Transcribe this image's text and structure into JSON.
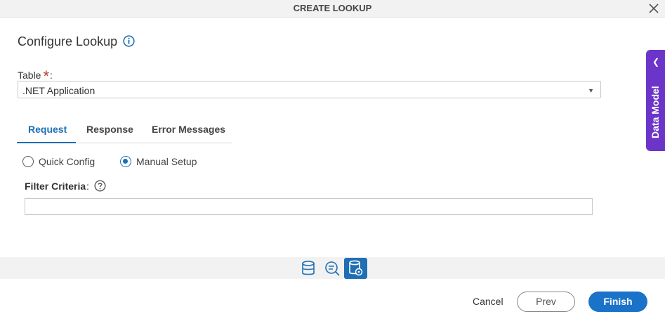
{
  "window": {
    "title": "CREATE LOOKUP",
    "close_icon": "close-icon"
  },
  "page": {
    "title": "Configure Lookup",
    "info_icon": "info-icon"
  },
  "table": {
    "label": "Table",
    "required_mark": "*",
    "colon": ":",
    "selected": ".NET Application"
  },
  "tabs": [
    {
      "label": "Request",
      "active": true
    },
    {
      "label": "Response",
      "active": false
    },
    {
      "label": "Error Messages",
      "active": false
    }
  ],
  "mode": {
    "options": [
      {
        "label": "Quick Config",
        "checked": false
      },
      {
        "label": "Manual Setup",
        "checked": true
      }
    ]
  },
  "filter": {
    "label": "Filter Criteria",
    "colon": ":",
    "value": "",
    "help_icon": "help-icon"
  },
  "side_panel": {
    "label": "Data Model",
    "icon": "chevron-left-icon"
  },
  "toolbar": {
    "icons": [
      "database-icon",
      "search-list-icon",
      "database-settings-icon"
    ],
    "active_index": 2
  },
  "footer": {
    "cancel_label": "Cancel",
    "prev_label": "Prev",
    "finish_label": "Finish"
  },
  "colors": {
    "accent": "#1f6fb5",
    "side_tab": "#6c35c9",
    "finish": "#1a73c9"
  }
}
